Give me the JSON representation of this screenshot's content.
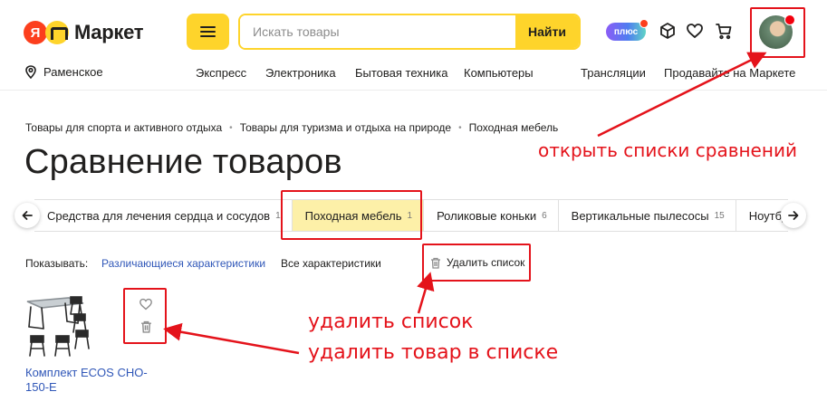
{
  "header": {
    "logo_ya": "Я",
    "logo_text": "Маркет",
    "search": {
      "placeholder": "Искать товары",
      "button_label": "Найти"
    },
    "plus_label": "плюс",
    "region": "Раменское",
    "nav_links": [
      "Экспресс",
      "Электроника",
      "Бытовая техника",
      "Компьютеры",
      "Трансляции",
      "Продавайте на Маркете"
    ]
  },
  "breadcrumbs": [
    "Товары для спорта и активного отдыха",
    "Товары для туризма и отдыха на природе",
    "Походная мебель"
  ],
  "page_title": "Сравнение товаров",
  "tabs": [
    {
      "label": "Средства для лечения сердца и сосудов",
      "count": "1"
    },
    {
      "label": "Походная мебель",
      "count": "1"
    },
    {
      "label": "Роликовые коньки",
      "count": "6"
    },
    {
      "label": "Вертикальные пылесосы",
      "count": "15"
    },
    {
      "label": "Ноутбуки",
      "count": ""
    }
  ],
  "active_tab_index": 1,
  "filters": {
    "show_label": "Показывать:",
    "option_diff": "Различающиеся характеристики",
    "option_all": "Все характеристики",
    "delete_list": "Удалить список"
  },
  "product": {
    "name": "Комплект ECOS CHO-150-E"
  },
  "annotations": {
    "open_lists": "открыть списки сравнений",
    "delete_list": "удалить список",
    "delete_item": "удалить товар в списке"
  },
  "colors": {
    "accent_yellow": "#fed42b",
    "brand_red": "#fc3f1d",
    "annotation_red": "#e4131b",
    "link_blue": "#3057b8",
    "active_tab_bg": "#fdf0a8"
  }
}
